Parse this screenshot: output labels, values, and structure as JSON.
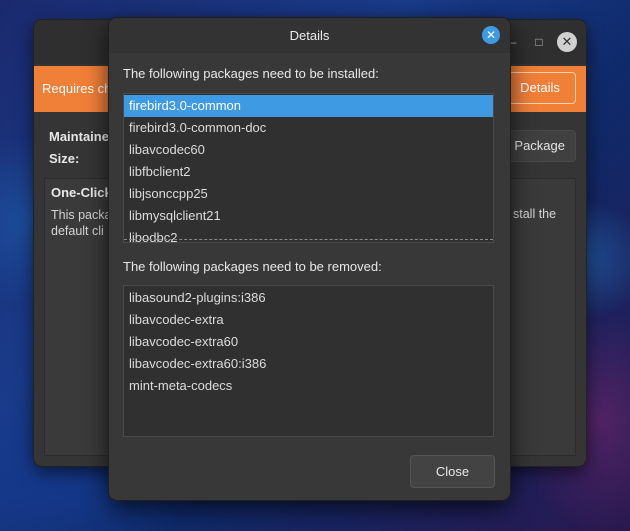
{
  "background_window": {
    "banner_text": "Requires ch",
    "banner_button": "Details",
    "maintainer_label": "Maintaine",
    "size_label": "Size:",
    "package_button": "Package",
    "description_title": "One-Click",
    "description_line1": "This packa",
    "description_line2": "default cli",
    "description_right": "stall the",
    "minimize_glyph": "–",
    "maximize_glyph": "□",
    "close_glyph": "✕",
    "accent_color": "#f07f38"
  },
  "dialog": {
    "title": "Details",
    "close_glyph": "✕",
    "install_label": "The following packages need to be installed:",
    "install_packages": [
      "firebird3.0-common",
      "firebird3.0-common-doc",
      "libavcodec60",
      "libfbclient2",
      "libjsonccpp25",
      "libmysqlclient21",
      "libodbc2"
    ],
    "selected_index": 0,
    "remove_label": "The following packages need to be removed:",
    "remove_packages": [
      "libasound2-plugins:i386",
      "libavcodec-extra",
      "libavcodec-extra60",
      "libavcodec-extra60:i386",
      "mint-meta-codecs"
    ],
    "close_button": "Close",
    "selection_color": "#3d9ae3"
  }
}
